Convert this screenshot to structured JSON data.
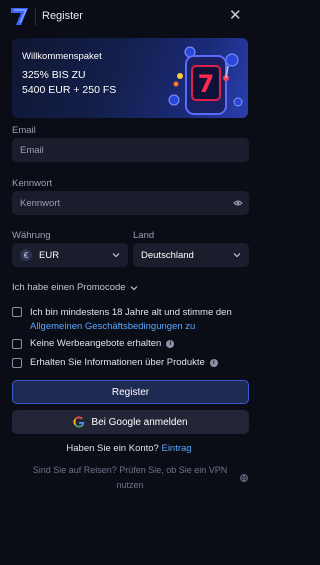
{
  "header": {
    "title": "Register"
  },
  "banner": {
    "line1": "Willkommenspaket",
    "line2": "325% BIS ZU",
    "line3": "5400 EUR + 250 FS",
    "slot_digit": "7"
  },
  "form": {
    "email_label": "Email",
    "email_placeholder": "Email",
    "password_label": "Kennwort",
    "password_placeholder": "Kennwort",
    "currency_label": "Währung",
    "currency_value": "EUR",
    "currency_symbol": "€",
    "country_label": "Land",
    "country_value": "Deutschland",
    "promo_label": "Ich habe einen Promocode"
  },
  "checkboxes": {
    "terms_text": "Ich bin mindestens 18 Jahre alt und stimme den",
    "terms_link": "Allgemeinen Geschäftsbedingungen zu",
    "no_ads": "Keine Werbeangebote erhalten",
    "product_info": "Erhalten Sie Informationen über Produkte",
    "info_glyph": "i"
  },
  "buttons": {
    "register": "Register",
    "google": "Bei Google anmelden"
  },
  "footer": {
    "have_account": "Haben Sie ein Konto?",
    "login_link": "Eintrag",
    "vpn_text": "Sind Sie auf Reisen? Prüfen Sie, ob Sie ein VPN nutzen"
  },
  "colors": {
    "background": "#0b0d16",
    "input_bg": "#1a1d2c",
    "accent_link": "#5aa6ff",
    "register_border": "#3a5bd0"
  }
}
